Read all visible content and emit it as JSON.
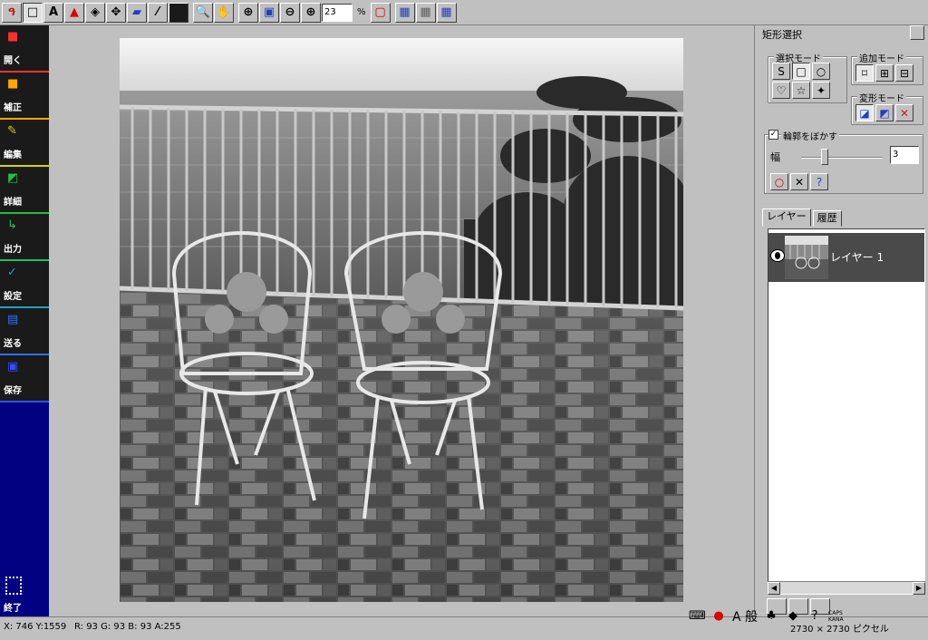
{
  "toolbar": {
    "zoom_value": "23",
    "zoom_unit": "%",
    "icons": [
      "lasso-icon",
      "rect-select-icon",
      "text-icon",
      "color-icon",
      "fill-icon",
      "move-icon",
      "brush-icon",
      "eyedropper-icon",
      "color-swatch-icon",
      "zoom-icon",
      "hand-icon",
      "zoom-fit-icon",
      "zoom-window-icon",
      "zoom-out-icon",
      "zoom-in-icon",
      "frame-icon",
      "grid1-icon",
      "grid2-icon",
      "grid3-icon"
    ]
  },
  "sidebar": {
    "items": [
      {
        "label": "開く",
        "icon": "camera-icon",
        "accent": "#ff3030"
      },
      {
        "label": "補正",
        "icon": "adjust-icon",
        "accent": "#ffa500"
      },
      {
        "label": "編集",
        "icon": "pencil-icon",
        "accent": "#d4d400"
      },
      {
        "label": "詳細",
        "icon": "detail-icon",
        "accent": "#20c040"
      },
      {
        "label": "出力",
        "icon": "output-icon",
        "accent": "#20c060"
      },
      {
        "label": "設定",
        "icon": "wrench-icon",
        "accent": "#20a0c0"
      },
      {
        "label": "送る",
        "icon": "send-icon",
        "accent": "#3070ff"
      },
      {
        "label": "保存",
        "icon": "save-icon",
        "accent": "#3050ff"
      }
    ],
    "quit_label": "終了"
  },
  "panel": {
    "title": "矩形選択",
    "selection_mode_title": "選択モード",
    "add_mode_title": "追加モード",
    "transform_mode_title": "変形モード",
    "feather_label": "輪郭をぼかす",
    "width_label": "幅",
    "width_value": "3",
    "feather_checked": true,
    "tabs": [
      "レイヤー",
      "履歴"
    ],
    "layer_name": "レイヤー 1"
  },
  "status": {
    "coords": "X: 746 Y:1559",
    "rgb": "R: 93 G: 93 B: 93 A:255",
    "image_size": "2730 × 2730 ピクセル",
    "ime_text": "A 般",
    "caps": "CAPS",
    "kana": "KANA"
  },
  "colors": {
    "sidebar_bg": "#000080",
    "layer_selected": "#4a4a4a",
    "ui_gray": "#c0c0c0"
  }
}
